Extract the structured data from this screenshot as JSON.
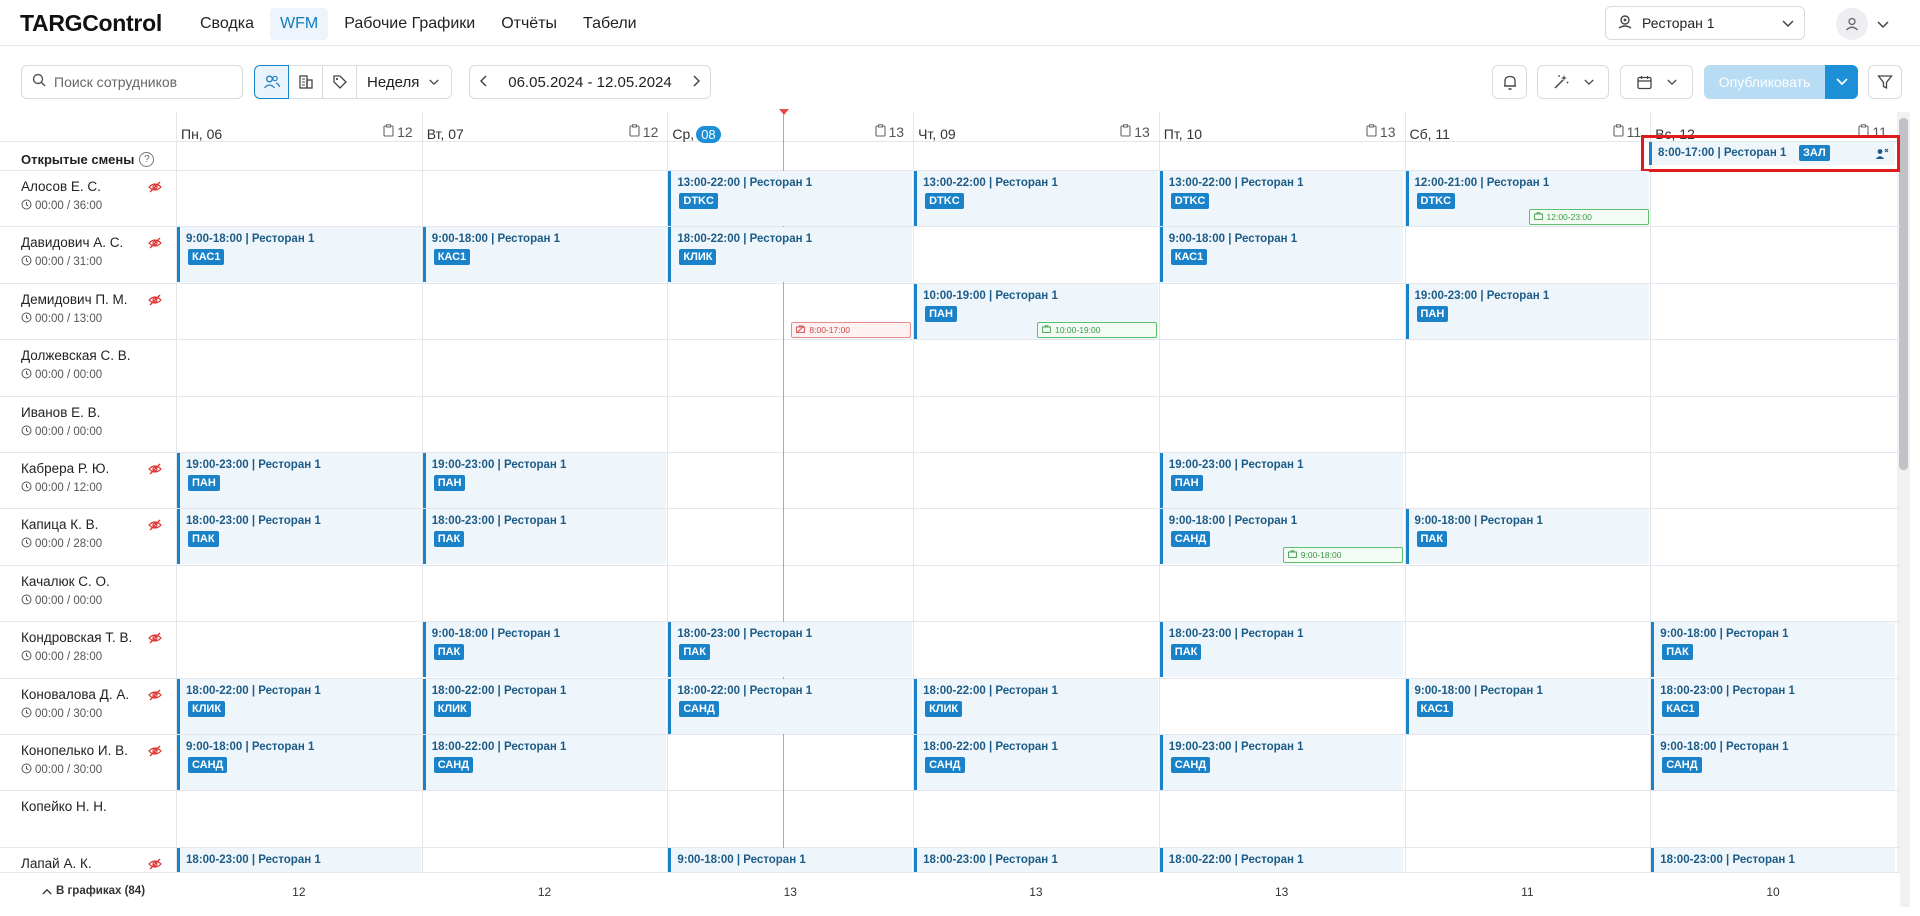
{
  "app": {
    "logo": "TARGControl"
  },
  "nav": {
    "items": [
      "Сводка",
      "WFM",
      "Рабочие Графики",
      "Отчёты",
      "Табели"
    ],
    "active_index": 1
  },
  "restaurant": {
    "label": "Ресторан 1"
  },
  "toolbar": {
    "search_placeholder": "Поиск сотрудников",
    "period": "Неделя",
    "date_range": "06.05.2024 - 12.05.2024",
    "publish_label": "Опубликовать"
  },
  "days": [
    {
      "label": "Пн, 06",
      "count": "12"
    },
    {
      "label": "Вт, 07",
      "count": "12"
    },
    {
      "label": "Ср,",
      "badge": "08",
      "count": "13"
    },
    {
      "label": "Чт, 09",
      "count": "13"
    },
    {
      "label": "Пт, 10",
      "count": "13"
    },
    {
      "label": "Сб, 11",
      "count": "11"
    },
    {
      "label": "Вс, 12",
      "count": "11"
    }
  ],
  "open_shifts": {
    "label": "Открытые смены",
    "help": "?",
    "items": [
      {
        "day": 6,
        "time": "8:00-17:00 | Ресторан 1",
        "tag": "ЗАЛ"
      }
    ]
  },
  "employees": [
    {
      "name": "Алосов Е. С.",
      "hours": "00:00 / 36:00",
      "hidden": true,
      "shifts": [
        {
          "day": 2,
          "time": "13:00-22:00 | Ресторан 1",
          "tag": "DTKC"
        },
        {
          "day": 3,
          "time": "13:00-22:00 | Ресторан 1",
          "tag": "DTKC"
        },
        {
          "day": 4,
          "time": "13:00-22:00 | Ресторан 1",
          "tag": "DTKC"
        },
        {
          "day": 5,
          "time": "12:00-21:00 | Ресторан 1",
          "tag": "DTKC"
        }
      ],
      "avail": [
        {
          "day": 5,
          "text": "12:00-23:00"
        }
      ]
    },
    {
      "name": "Давидович А. С.",
      "hours": "00:00 / 31:00",
      "hidden": true,
      "shifts": [
        {
          "day": 0,
          "time": "9:00-18:00 | Ресторан 1",
          "tag": "КАС1"
        },
        {
          "day": 1,
          "time": "9:00-18:00 | Ресторан 1",
          "tag": "КАС1"
        },
        {
          "day": 2,
          "time": "18:00-22:00 | Ресторан 1",
          "tag": "КЛИК"
        },
        {
          "day": 4,
          "time": "9:00-18:00 | Ресторан 1",
          "tag": "КАС1"
        }
      ]
    },
    {
      "name": "Демидович П. М.",
      "hours": "00:00 / 13:00",
      "hidden": true,
      "shifts": [
        {
          "day": 3,
          "time": "10:00-19:00 | Ресторан 1",
          "tag": "ПАН"
        },
        {
          "day": 5,
          "time": "19:00-23:00 | Ресторан 1",
          "tag": "ПАН"
        }
      ],
      "avail": [
        {
          "day": 3,
          "text": "10:00-19:00"
        }
      ],
      "unavail": [
        {
          "day": 2,
          "text": "8:00-17:00"
        }
      ]
    },
    {
      "name": "Должевская С. В.",
      "hours": "00:00 / 00:00",
      "hidden": false,
      "shifts": []
    },
    {
      "name": "Иванов Е. В.",
      "hours": "00:00 / 00:00",
      "hidden": false,
      "shifts": []
    },
    {
      "name": "Кабрера Р. Ю.",
      "hours": "00:00 / 12:00",
      "hidden": true,
      "shifts": [
        {
          "day": 0,
          "time": "19:00-23:00 | Ресторан 1",
          "tag": "ПАН"
        },
        {
          "day": 1,
          "time": "19:00-23:00 | Ресторан 1",
          "tag": "ПАН"
        },
        {
          "day": 4,
          "time": "19:00-23:00 | Ресторан 1",
          "tag": "ПАН"
        }
      ]
    },
    {
      "name": "Капица К. В.",
      "hours": "00:00 / 28:00",
      "hidden": true,
      "shifts": [
        {
          "day": 0,
          "time": "18:00-23:00 | Ресторан 1",
          "tag": "ПАК"
        },
        {
          "day": 1,
          "time": "18:00-23:00 | Ресторан 1",
          "tag": "ПАК"
        },
        {
          "day": 4,
          "time": "9:00-18:00 | Ресторан 1",
          "tag": "САНД"
        },
        {
          "day": 5,
          "time": "9:00-18:00 | Ресторан 1",
          "tag": "ПАК"
        }
      ],
      "avail": [
        {
          "day": 4,
          "text": "9:00-18:00"
        }
      ]
    },
    {
      "name": "Качалюк С. О.",
      "hours": "00:00 / 00:00",
      "hidden": false,
      "shifts": []
    },
    {
      "name": "Кондровская Т. В.",
      "hours": "00:00 / 28:00",
      "hidden": true,
      "shifts": [
        {
          "day": 1,
          "time": "9:00-18:00 | Ресторан 1",
          "tag": "ПАК"
        },
        {
          "day": 2,
          "time": "18:00-23:00 | Ресторан 1",
          "tag": "ПАК"
        },
        {
          "day": 4,
          "time": "18:00-23:00 | Ресторан 1",
          "tag": "ПАК"
        },
        {
          "day": 6,
          "time": "9:00-18:00 | Ресторан 1",
          "tag": "ПАК"
        }
      ]
    },
    {
      "name": "Коновалова Д. А.",
      "hours": "00:00 / 30:00",
      "hidden": true,
      "shifts": [
        {
          "day": 0,
          "time": "18:00-22:00 | Ресторан 1",
          "tag": "КЛИК"
        },
        {
          "day": 1,
          "time": "18:00-22:00 | Ресторан 1",
          "tag": "КЛИК"
        },
        {
          "day": 2,
          "time": "18:00-22:00 | Ресторан 1",
          "tag": "САНД"
        },
        {
          "day": 3,
          "time": "18:00-22:00 | Ресторан 1",
          "tag": "КЛИК"
        },
        {
          "day": 5,
          "time": "9:00-18:00 | Ресторан 1",
          "tag": "КАС1"
        },
        {
          "day": 6,
          "time": "18:00-23:00 | Ресторан 1",
          "tag": "КАС1"
        }
      ]
    },
    {
      "name": "Конопелько И. В.",
      "hours": "00:00 / 30:00",
      "hidden": true,
      "shifts": [
        {
          "day": 0,
          "time": "9:00-18:00 | Ресторан 1",
          "tag": "САНД"
        },
        {
          "day": 1,
          "time": "18:00-22:00 | Ресторан 1",
          "tag": "САНД"
        },
        {
          "day": 3,
          "time": "18:00-22:00 | Ресторан 1",
          "tag": "САНД"
        },
        {
          "day": 4,
          "time": "19:00-23:00 | Ресторан 1",
          "tag": "САНД"
        },
        {
          "day": 6,
          "time": "9:00-18:00 | Ресторан 1",
          "tag": "САНД"
        }
      ]
    },
    {
      "name": "Копейко Н. Н.",
      "hours": "",
      "hidden": false,
      "shifts": []
    },
    {
      "name": "Лапай А. К.",
      "hours": "",
      "hidden": true,
      "shifts": [
        {
          "day": 0,
          "time": "18:00-23:00 | Ресторан 1",
          "tag": ""
        },
        {
          "day": 2,
          "time": "9:00-18:00 | Ресторан 1",
          "tag": ""
        },
        {
          "day": 3,
          "time": "18:00-23:00 | Ресторан 1",
          "tag": ""
        },
        {
          "day": 4,
          "time": "18:00-22:00 | Ресторан 1",
          "tag": ""
        },
        {
          "day": 6,
          "time": "18:00-23:00 | Ресторан 1",
          "tag": ""
        }
      ]
    }
  ],
  "footer": {
    "label": "В графиках (84)",
    "counts": [
      "12",
      "12",
      "13",
      "13",
      "13",
      "11",
      "10"
    ]
  },
  "colors": {
    "accent": "#1a82c8",
    "shift_bg": "#eef6fc",
    "available": "#5cc16b",
    "unavailable": "#e58d8d",
    "highlight": "#e01b1b"
  }
}
